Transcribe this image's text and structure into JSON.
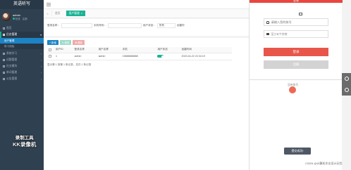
{
  "app": {
    "brand": "英语听写"
  },
  "user": {
    "name": "admin",
    "status": "在线",
    "logout": "注销"
  },
  "sidebar": {
    "items": [
      {
        "label": "首页"
      },
      {
        "label": "后台管理"
      },
      {
        "label": "用户管理"
      },
      {
        "label": "练习测验"
      },
      {
        "label": "系统学习"
      },
      {
        "label": "试题管理"
      },
      {
        "label": "社交模块"
      },
      {
        "label": "单词管理"
      },
      {
        "label": "公告管理"
      }
    ]
  },
  "watermark": {
    "line1": "录制工具",
    "line2": "KK录像机"
  },
  "tabs": {
    "home": "首页",
    "active": "用户管理"
  },
  "search": {
    "account_label": "登录名称：",
    "phone_label": "手机号码：",
    "status_label": "用户状态：",
    "status_value": "所有",
    "time_label": "创建时"
  },
  "toolbar": {
    "add": "+ 新增",
    "edit": "✎ 修改",
    "delete": "✖ 删除"
  },
  "table": {
    "headers": [
      "",
      "用户ID",
      "登录名称",
      "用户名称",
      "手机",
      "用户状态",
      "创建时间"
    ],
    "rows": [
      {
        "id": "1",
        "login": "admin",
        "name": "admin",
        "phone": "15888888888",
        "time": "2023-04-22 22:34:19"
      }
    ]
  },
  "pager": "显示第 1 到第 1 条记录，总共 1 条记录",
  "login_panel": {
    "title": "登录",
    "username_placeholder": "请输入您的账号",
    "password_placeholder": "至少6个字符",
    "login_button": "登录",
    "register_button": "注册",
    "note": "没有账号",
    "toast": "提交成功!"
  },
  "credit": "CSDN @计算机毕业设计无忧",
  "colors": {
    "sidebar_bg": "#2f4050",
    "accent": "#1ab394",
    "primary": "#1c84c6",
    "danger": "#e8564a"
  }
}
